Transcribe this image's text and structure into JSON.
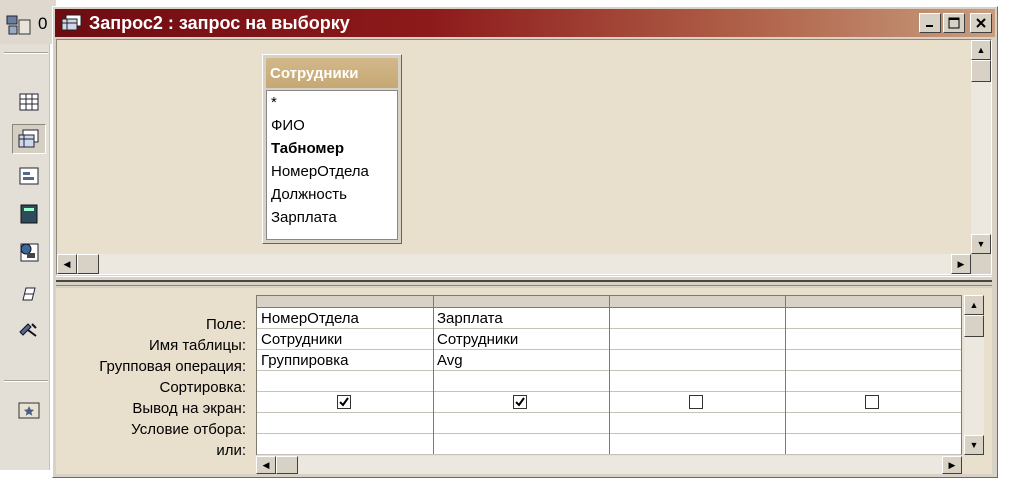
{
  "window": {
    "title": "Запрос2 : запрос на выборку"
  },
  "db_window": {
    "counter": "0"
  },
  "table_box": {
    "title": "Сотрудники",
    "fields": [
      {
        "label": "*",
        "bold": false
      },
      {
        "label": "ФИО",
        "bold": false
      },
      {
        "label": "Табномер",
        "bold": true
      },
      {
        "label": "НомерОтдела",
        "bold": false
      },
      {
        "label": "Должность",
        "bold": false
      },
      {
        "label": "Зарплата",
        "bold": false
      }
    ]
  },
  "grid": {
    "row_labels": [
      "Поле:",
      "Имя таблицы:",
      "Групповая операция:",
      "Сортировка:",
      "Вывод на экран:",
      "Условие отбора:",
      "или:"
    ],
    "columns": [
      {
        "field": "НомерОтдела",
        "table": "Сотрудники",
        "group": "Группировка",
        "sort": "",
        "show": true,
        "criteria": "",
        "or": ""
      },
      {
        "field": "Зарплата",
        "table": "Сотрудники",
        "group": "Avg",
        "sort": "",
        "show": true,
        "criteria": "",
        "or": ""
      },
      {
        "field": "",
        "table": "",
        "group": "",
        "sort": "",
        "show": false,
        "criteria": "",
        "or": ""
      },
      {
        "field": "",
        "table": "",
        "group": "",
        "sort": "",
        "show": false,
        "criteria": "",
        "or": ""
      }
    ]
  },
  "colors": {
    "title_start": "#6e0c12",
    "title_end": "#c79d7e",
    "pane_bg": "#e9dfcd",
    "table_title": "#c6a874"
  }
}
